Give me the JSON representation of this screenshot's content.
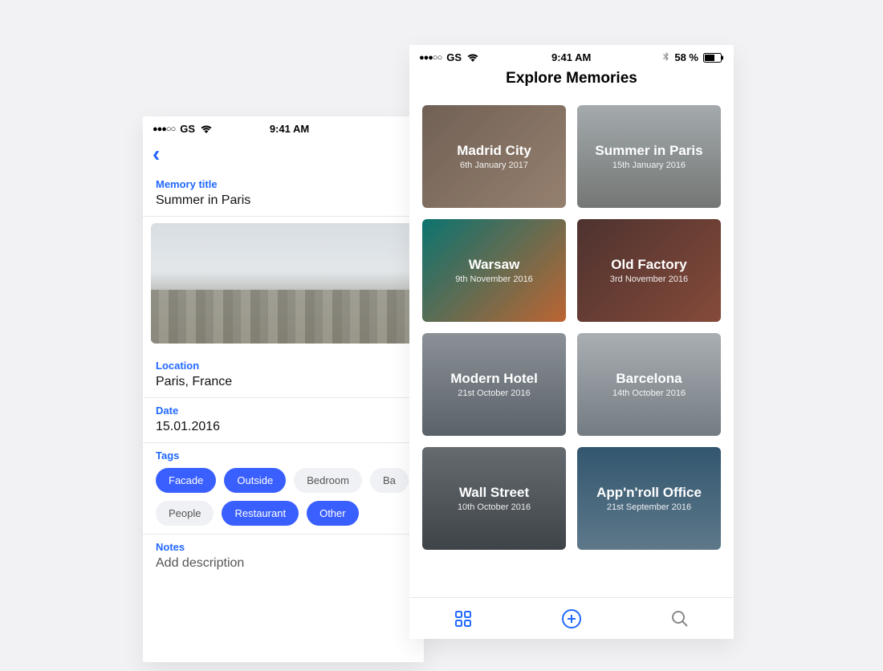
{
  "status": {
    "dots": "●●●○○",
    "carrier": "GS",
    "time": "9:41 AM",
    "battery_text": "58 %"
  },
  "left": {
    "memory_title_label": "Memory title",
    "memory_title_value": "Summer in Paris",
    "location_label": "Location",
    "location_value": "Paris, France",
    "date_label": "Date",
    "date_value": "15.01.2016",
    "tags_label": "Tags",
    "tags": [
      {
        "label": "Facade",
        "active": true
      },
      {
        "label": "Outside",
        "active": true
      },
      {
        "label": "Bedroom",
        "active": false
      },
      {
        "label": "Ba",
        "active": false
      },
      {
        "label": "People",
        "active": false
      },
      {
        "label": "Restaurant",
        "active": true
      },
      {
        "label": "Other",
        "active": true
      }
    ],
    "notes_label": "Notes",
    "notes_placeholder": "Add description"
  },
  "right": {
    "title": "Explore Memories",
    "cards": [
      {
        "title": "Madrid City",
        "date": "6th January 2017"
      },
      {
        "title": "Summer in Paris",
        "date": "15th January 2016"
      },
      {
        "title": "Warsaw",
        "date": "9th November 2016"
      },
      {
        "title": "Old Factory",
        "date": "3rd November 2016"
      },
      {
        "title": "Modern Hotel",
        "date": "21st October 2016"
      },
      {
        "title": "Barcelona",
        "date": "14th October 2016"
      },
      {
        "title": "Wall Street",
        "date": "10th October 2016"
      },
      {
        "title": "App'n'roll Office",
        "date": "21st September 2016"
      }
    ]
  }
}
